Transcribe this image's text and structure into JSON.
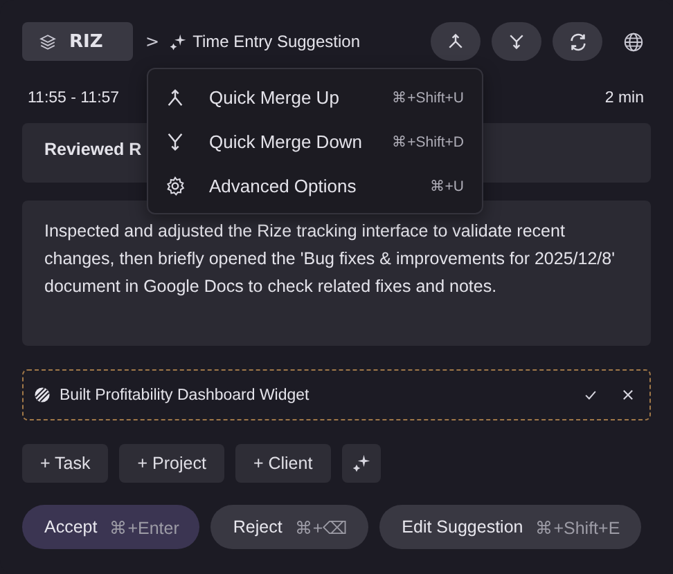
{
  "header": {
    "workspace": "RIZ",
    "separator": ">",
    "breadcrumb": "Time Entry Suggestion"
  },
  "time_range": "11:55 - 11:57",
  "duration": "2 min",
  "title": "Reviewed R",
  "description": "Inspected and adjusted the Rize tracking interface to validate recent changes, then briefly opened the 'Bug fixes & improvements for 2025/12/8' document in Google Docs to check related fixes and notes.",
  "task": {
    "name": "Built Profitability Dashboard Widget"
  },
  "add_buttons": [
    "+ Task",
    "+ Project",
    "+ Client"
  ],
  "actions": [
    {
      "label": "Accept",
      "shortcut": "⌘+Enter",
      "kind": "primary"
    },
    {
      "label": "Reject",
      "shortcut": "⌘+⌫",
      "kind": "secondary"
    },
    {
      "label": "Edit Suggestion",
      "shortcut": "⌘+Shift+E",
      "kind": "secondary"
    }
  ],
  "menu": [
    {
      "label": "Quick Merge Up",
      "shortcut": "⌘+Shift+U"
    },
    {
      "label": "Quick Merge Down",
      "shortcut": "⌘+Shift+D"
    },
    {
      "label": "Advanced Options",
      "shortcut": "⌘+U"
    }
  ]
}
